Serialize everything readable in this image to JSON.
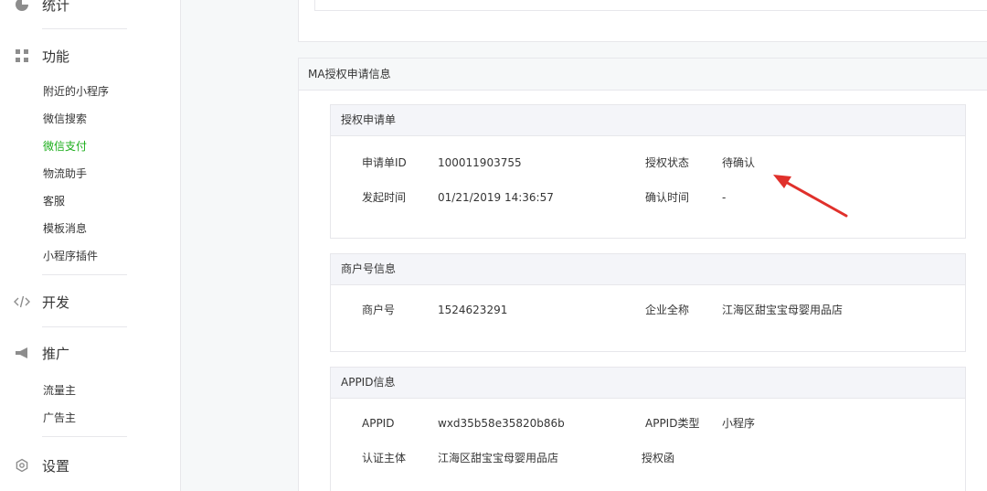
{
  "sidebar": {
    "stats_label": "统计",
    "features": {
      "label": "功能",
      "items": [
        "附近的小程序",
        "微信搜索",
        "微信支付",
        "物流助手",
        "客服",
        "模板消息",
        "小程序插件"
      ],
      "active": "微信支付"
    },
    "develop_label": "开发",
    "promote": {
      "label": "推广",
      "items": [
        "流量主",
        "广告主"
      ]
    },
    "settings_label": "设置"
  },
  "section_title": "MA授权申请信息",
  "auth_form": {
    "title": "授权申请单",
    "id_label": "申请单ID",
    "id_value": "100011903755",
    "status_label": "授权状态",
    "status_value": "待确认",
    "created_label": "发起时间",
    "created_value": "01/21/2019 14:36:57",
    "confirmed_label": "确认时间",
    "confirmed_value": "-"
  },
  "merchant": {
    "title": "商户号信息",
    "mch_label": "商户号",
    "mch_value": "1524623291",
    "company_label": "企业全称",
    "company_value": "江海区甜宝宝母婴用品店"
  },
  "appid_info": {
    "title": "APPID信息",
    "appid_label": "APPID",
    "appid_value": "wxd35b58e35820b86b",
    "type_label": "APPID类型",
    "type_value": "小程序",
    "subject_label": "认证主体",
    "subject_value": "江海区甜宝宝母婴用品店",
    "letter_label": "授权函"
  },
  "colors": {
    "active_green": "#1aad19",
    "arrow_red": "#e0302b"
  }
}
